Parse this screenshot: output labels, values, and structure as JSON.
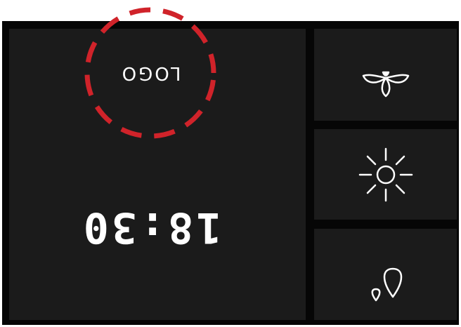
{
  "colors": {
    "frame": "#060606",
    "panel": "#1b1b1b",
    "text": "#ffffff",
    "logo_ring": "#d0232a"
  },
  "logo": {
    "text": "LOGO",
    "outline": "dashed-circle"
  },
  "clock": {
    "time": "18:30",
    "orientation": "upside-down"
  },
  "tiles": [
    {
      "icon": "fan-icon"
    },
    {
      "icon": "sun-icon"
    },
    {
      "icon": "water-drops-icon"
    }
  ]
}
